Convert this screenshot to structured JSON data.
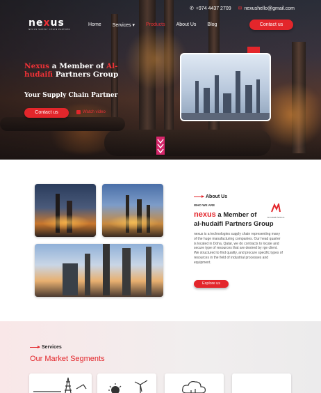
{
  "topbar": {
    "phone": "+974 4437 2709",
    "email": "nexushello@gmail.com"
  },
  "logo": {
    "text_a": "ne",
    "text_b": "x",
    "text_c": "us",
    "tagline": "NEXUS SUPPLY CHAIN PARTNER"
  },
  "nav": {
    "items": [
      {
        "label": "Home"
      },
      {
        "label": "Services ▾"
      },
      {
        "label": "Products"
      },
      {
        "label": "About Us"
      },
      {
        "label": "Blog"
      }
    ],
    "active_index": 2
  },
  "header_cta": "Contact us",
  "hero": {
    "title_a": "Nexus",
    "title_b": " a Member of ",
    "title_c": "Al-hudaifi",
    "title_d": " Partners Group",
    "subtitle": "Your Supply Chain Partner",
    "contact_label": "Contact us",
    "watch_label": "Watch video"
  },
  "about": {
    "label": "About Us",
    "who": "WHO WE ARE",
    "heading_a": "nexus",
    "heading_b": " a Member of",
    "heading_c": "al-hudaifi Partners Group",
    "partner_logo_text": "Al-hudaifi Partners",
    "body": "nexus is a technologies supply chain representing many of the huge manufacturing companies. Our head quarter is located in Doha, Qatar, we do contracts to locate and secure type of resources that are desired by rge client. We structured to find quality, and procure specific types of resources in the field of industrial processes and equipment.",
    "explore": "Explore us"
  },
  "services": {
    "label": "Services",
    "heading": "Our Market Segments"
  },
  "colors": {
    "brand_red": "#e3262b",
    "dark": "#222222"
  }
}
